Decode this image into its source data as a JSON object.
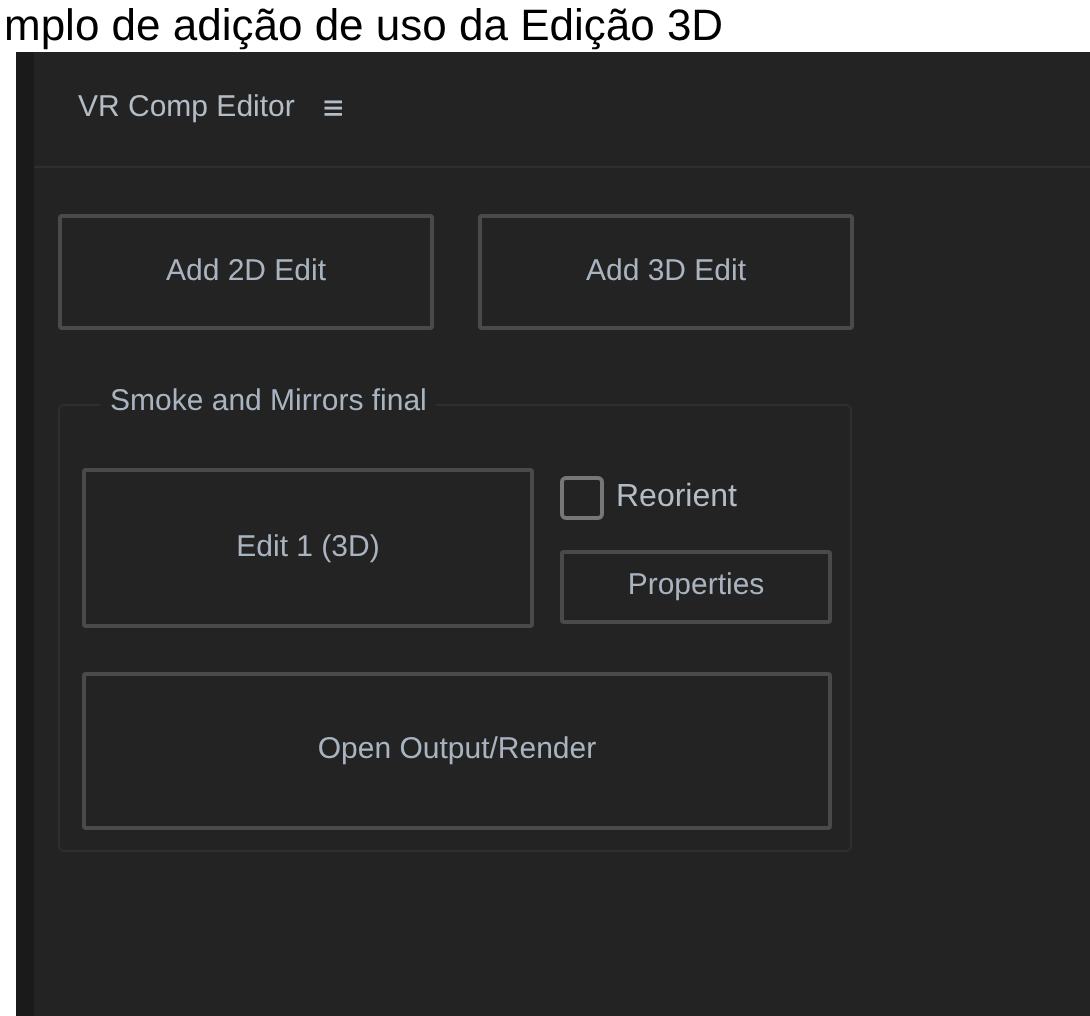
{
  "caption": "mplo de adição de uso da Edição 3D",
  "panel": {
    "title": "VR Comp Editor",
    "menu_icon": "≡"
  },
  "add_buttons": [
    "Add 2D Edit",
    "Add 3D Edit"
  ],
  "group": {
    "title": "Smoke and Mirrors final",
    "edit_button": "Edit 1 (3D)",
    "reorient": {
      "label": "Reorient",
      "checked": false
    },
    "properties_button": "Properties",
    "output_button": "Open Output/Render"
  }
}
